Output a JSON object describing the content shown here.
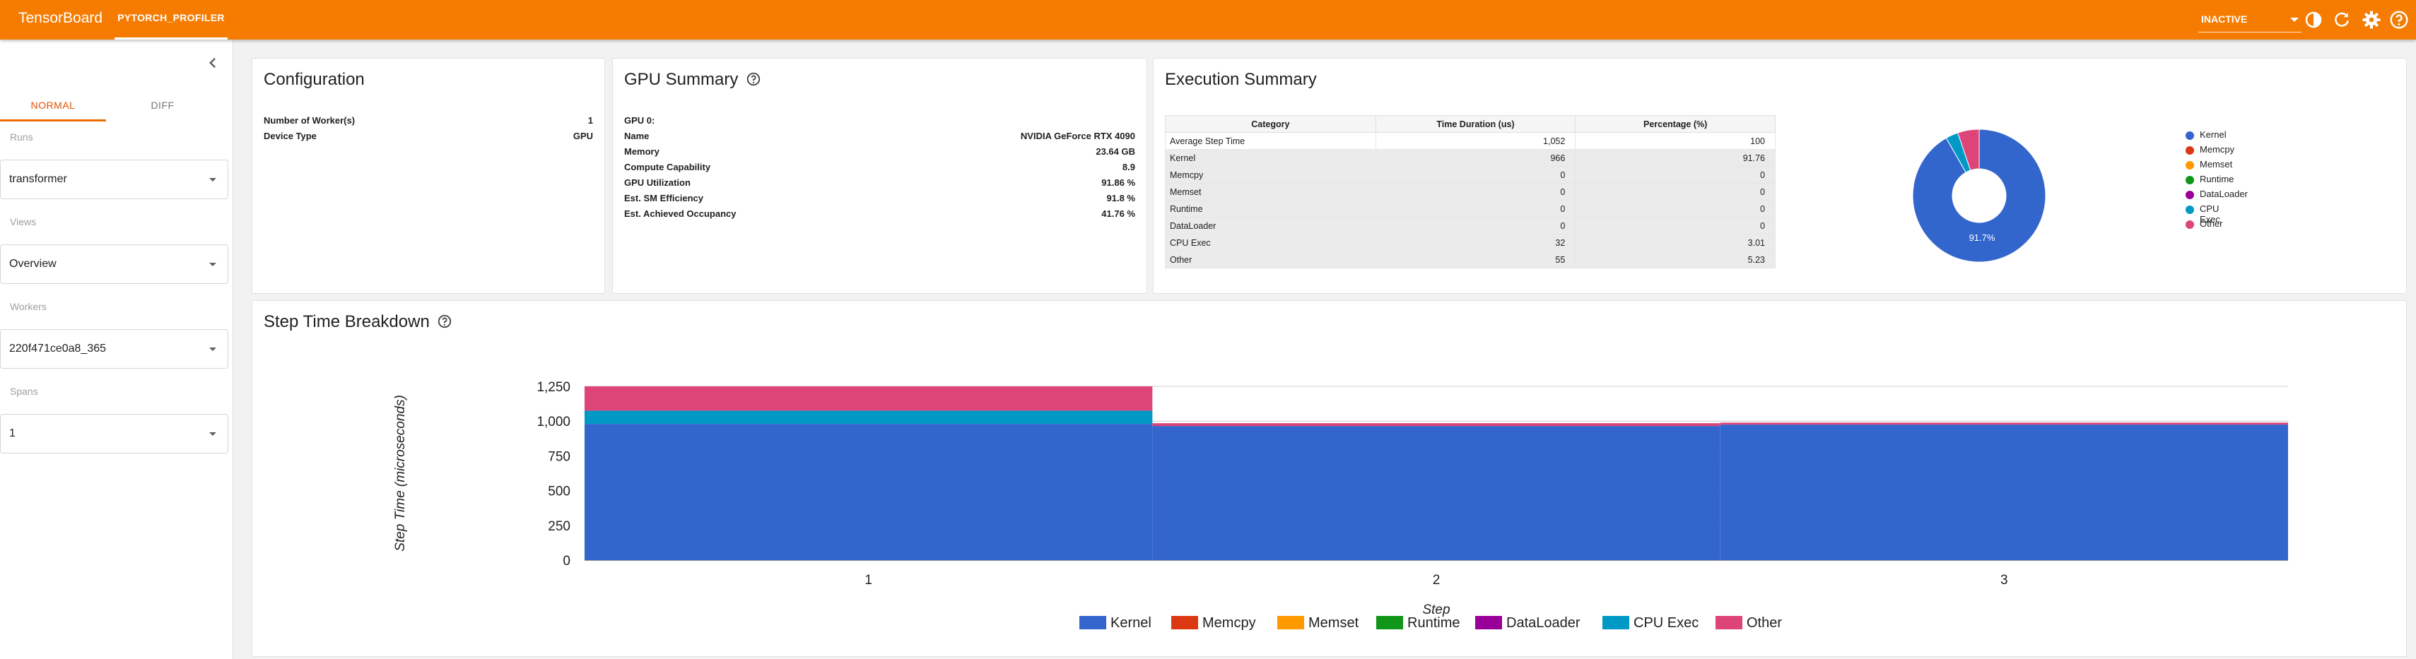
{
  "app": {
    "brand": "TensorBoard",
    "plugin_tab": "PYTORCH_PROFILER",
    "status": "INACTIVE",
    "icons": [
      "theme-toggle-icon",
      "refresh-icon",
      "settings-icon",
      "help-icon"
    ],
    "accent_color": "#f57c00"
  },
  "sidebar": {
    "tabs": [
      {
        "label": "NORMAL",
        "active": true
      },
      {
        "label": "DIFF",
        "active": false
      }
    ],
    "runs": {
      "label": "Runs",
      "value": "transformer"
    },
    "views": {
      "label": "Views",
      "value": "Overview"
    },
    "workers": {
      "label": "Workers",
      "value": "220f471ce0a8_365"
    },
    "spans": {
      "label": "Spans",
      "value": "1"
    }
  },
  "configuration": {
    "title": "Configuration",
    "rows": [
      {
        "key": "Number of Worker(s)",
        "value": "1"
      },
      {
        "key": "Device Type",
        "value": "GPU"
      }
    ]
  },
  "gpu_summary": {
    "title": "GPU Summary",
    "rows": [
      {
        "key": "GPU 0:",
        "value": ""
      },
      {
        "key": "Name",
        "value": "NVIDIA GeForce RTX 4090"
      },
      {
        "key": "Memory",
        "value": "23.64 GB"
      },
      {
        "key": "Compute Capability",
        "value": "8.9"
      },
      {
        "key": "GPU Utilization",
        "value": "91.86 %"
      },
      {
        "key": "Est. SM Efficiency",
        "value": "91.8 %"
      },
      {
        "key": "Est. Achieved Occupancy",
        "value": "41.76 %"
      }
    ]
  },
  "execution_summary": {
    "title": "Execution Summary",
    "columns": [
      "Category",
      "Time Duration (us)",
      "Percentage (%)"
    ],
    "rows": [
      [
        "Average Step Time",
        "1,052",
        "100"
      ],
      [
        "Kernel",
        "966",
        "91.76"
      ],
      [
        "Memcpy",
        "0",
        "0"
      ],
      [
        "Memset",
        "0",
        "0"
      ],
      [
        "Runtime",
        "0",
        "0"
      ],
      [
        "DataLoader",
        "0",
        "0"
      ],
      [
        "CPU Exec",
        "32",
        "3.01"
      ],
      [
        "Other",
        "55",
        "5.23"
      ]
    ],
    "scroll_hint": "< >",
    "donut_label": "91.7%",
    "donut_legend": [
      {
        "name": "Kernel",
        "color": "#3366cc"
      },
      {
        "name": "Memcpy",
        "color": "#dc3912"
      },
      {
        "name": "Memset",
        "color": "#ff9900"
      },
      {
        "name": "Runtime",
        "color": "#109618"
      },
      {
        "name": "DataLoader",
        "color": "#990099"
      },
      {
        "name": "CPU Exec",
        "color": "#0099c6"
      },
      {
        "name": "Other",
        "color": "#dd4477"
      }
    ]
  },
  "step_time": {
    "title": "Step Time Breakdown"
  },
  "chart_data": [
    {
      "type": "pie",
      "categories": [
        "Kernel",
        "Memcpy",
        "Memset",
        "Runtime",
        "DataLoader",
        "CPU Exec",
        "Other"
      ],
      "values": [
        966,
        0,
        0,
        0,
        0,
        32,
        55
      ],
      "slice_label": "91.7%",
      "donut": true,
      "legend": "right",
      "colors": [
        "#3366cc",
        "#dc3912",
        "#ff9900",
        "#109618",
        "#990099",
        "#0099c6",
        "#dd4477"
      ]
    },
    {
      "type": "area",
      "stacked": true,
      "title": "",
      "xlabel": "Step",
      "ylabel": "Step Time (microseconds)",
      "x": [
        1,
        2,
        3
      ],
      "ylim": [
        0,
        1250
      ],
      "yticks": [
        0,
        250,
        500,
        750,
        "1,000",
        "1,250"
      ],
      "legend": "bottom",
      "series": [
        {
          "name": "Kernel",
          "color": "#3366cc",
          "values": [
            980,
            965,
            975
          ]
        },
        {
          "name": "Memcpy",
          "color": "#dc3912",
          "values": [
            0,
            0,
            0
          ]
        },
        {
          "name": "Memset",
          "color": "#ff9900",
          "values": [
            0,
            0,
            0
          ]
        },
        {
          "name": "Runtime",
          "color": "#109618",
          "values": [
            0,
            0,
            0
          ]
        },
        {
          "name": "DataLoader",
          "color": "#990099",
          "values": [
            0,
            0,
            0
          ]
        },
        {
          "name": "CPU Exec",
          "color": "#0099c6",
          "values": [
            95,
            0,
            0
          ]
        },
        {
          "name": "Other",
          "color": "#dd4477",
          "values": [
            175,
            20,
            14
          ]
        }
      ]
    }
  ]
}
